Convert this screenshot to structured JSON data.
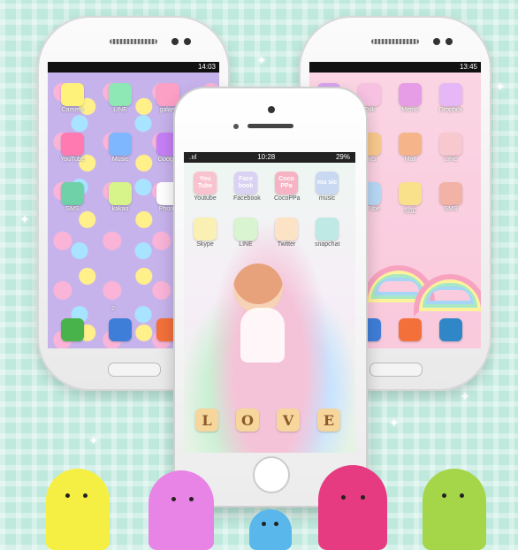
{
  "left_phone": {
    "time": "14:03",
    "icons": [
      {
        "label": "Camera",
        "color": "#fff27a"
      },
      {
        "label": "LINE",
        "color": "#8ee8b5"
      },
      {
        "label": "galary",
        "color": "#fca0c6"
      },
      {
        "label": "YouTube",
        "color": "#ff7ab0"
      },
      {
        "label": "Music",
        "color": "#7fb7ff"
      },
      {
        "label": "Google",
        "color": "#c67ff6"
      },
      {
        "label": "SMS",
        "color": "#6fd1a8"
      },
      {
        "label": "kakao",
        "color": "#d7f48a"
      },
      {
        "label": "Phone",
        "color": "#ffffff"
      }
    ],
    "dock": [
      {
        "label": "",
        "color": "#47b34a"
      },
      {
        "label": "",
        "color": "#3f7ed8"
      },
      {
        "label": "",
        "color": "#f3703a"
      }
    ],
    "page_dot": "2"
  },
  "right_phone": {
    "time": "13:45",
    "icons": [
      {
        "label": "",
        "color": "#d7a3f0"
      },
      {
        "label": "Talk",
        "color": "#f7c1e1"
      },
      {
        "label": "Memo",
        "color": "#e79ce6"
      },
      {
        "label": "Dropbox",
        "color": "#e7b6f6"
      },
      {
        "label": "",
        "color": "#f9d2a4"
      },
      {
        "label": "SMS",
        "color": "#f9c98d"
      },
      {
        "label": "Mail",
        "color": "#f5b48a"
      },
      {
        "label": "LINE",
        "color": "#f8c8cf"
      },
      {
        "label": "",
        "color": "#b6e3f2"
      },
      {
        "label": "ouTube",
        "color": "#b8d8f6"
      },
      {
        "label": "設定",
        "color": "#f9e08a"
      },
      {
        "label": "SMS",
        "color": "#f2b2a5"
      }
    ],
    "dock": [
      {
        "label": "",
        "color": "#3f7ed8"
      },
      {
        "label": "",
        "color": "#f3703a"
      },
      {
        "label": "",
        "color": "#2f87c8"
      }
    ]
  },
  "iphone": {
    "carrier": "",
    "time": "10:28",
    "battery": "29%",
    "icons": [
      {
        "label": "Youtube",
        "text": "You Tube",
        "color": "#f9c2cf"
      },
      {
        "label": "Facebook",
        "text": "Face book",
        "color": "#d9d2f2"
      },
      {
        "label": "CocoPPa",
        "text": "Coco PPa",
        "color": "#f5b3c4"
      },
      {
        "label": "music",
        "text": "mu sic",
        "color": "#c9d9f2"
      },
      {
        "label": "Skype",
        "text": "",
        "color": "#fbf0b3"
      },
      {
        "label": "LINE",
        "text": "",
        "color": "#d8f4d0"
      },
      {
        "label": "Twitter",
        "text": "",
        "color": "#fde3c6"
      },
      {
        "label": "snapchat",
        "text": "",
        "color": "#bfe9e5"
      }
    ],
    "dock": [
      "L",
      "O",
      "V",
      "E"
    ]
  }
}
